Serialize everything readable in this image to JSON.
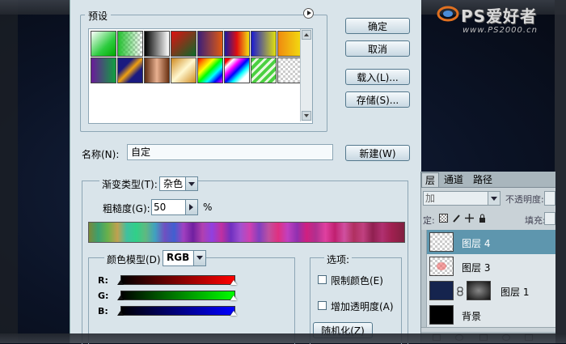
{
  "watermark": {
    "title": "PS爱好者",
    "url": "www.PS2000.cn"
  },
  "dialog": {
    "preset_label": "预设",
    "buttons": {
      "ok": "确定",
      "cancel": "取消",
      "load": "载入(L)...",
      "save": "存储(S)...",
      "new": "新建(W)"
    },
    "name_label": "名称(N):",
    "name_value": "自定",
    "gradient_type_label": "渐变类型(T):",
    "gradient_type_value": "杂色",
    "roughness_label": "粗糙度(G):",
    "roughness_value": "50",
    "roughness_unit": "%",
    "color_model_label": "颜色模型(D)",
    "color_model_value": "RGB",
    "channels": [
      "R:",
      "G:",
      "B:"
    ],
    "options_label": "选项:",
    "option_restrict": "限制颜色(E)",
    "option_transparency": "增加透明度(A)",
    "randomize": "随机化(Z)",
    "colors": {
      "dialog_bg": "#d9e4ea",
      "button_border": "#54788d"
    }
  },
  "layers": {
    "tabs": [
      "层",
      "通道",
      "路径"
    ],
    "blend_mode": "加",
    "opacity_label": "不透明度:",
    "lock_label": "定:",
    "fill_label": "填充:",
    "items": [
      {
        "name": "图层 4",
        "selected": true
      },
      {
        "name": "图层 3",
        "selected": false
      },
      {
        "name": "图层 1",
        "selected": false
      },
      {
        "name": "背景",
        "selected": false
      }
    ]
  }
}
